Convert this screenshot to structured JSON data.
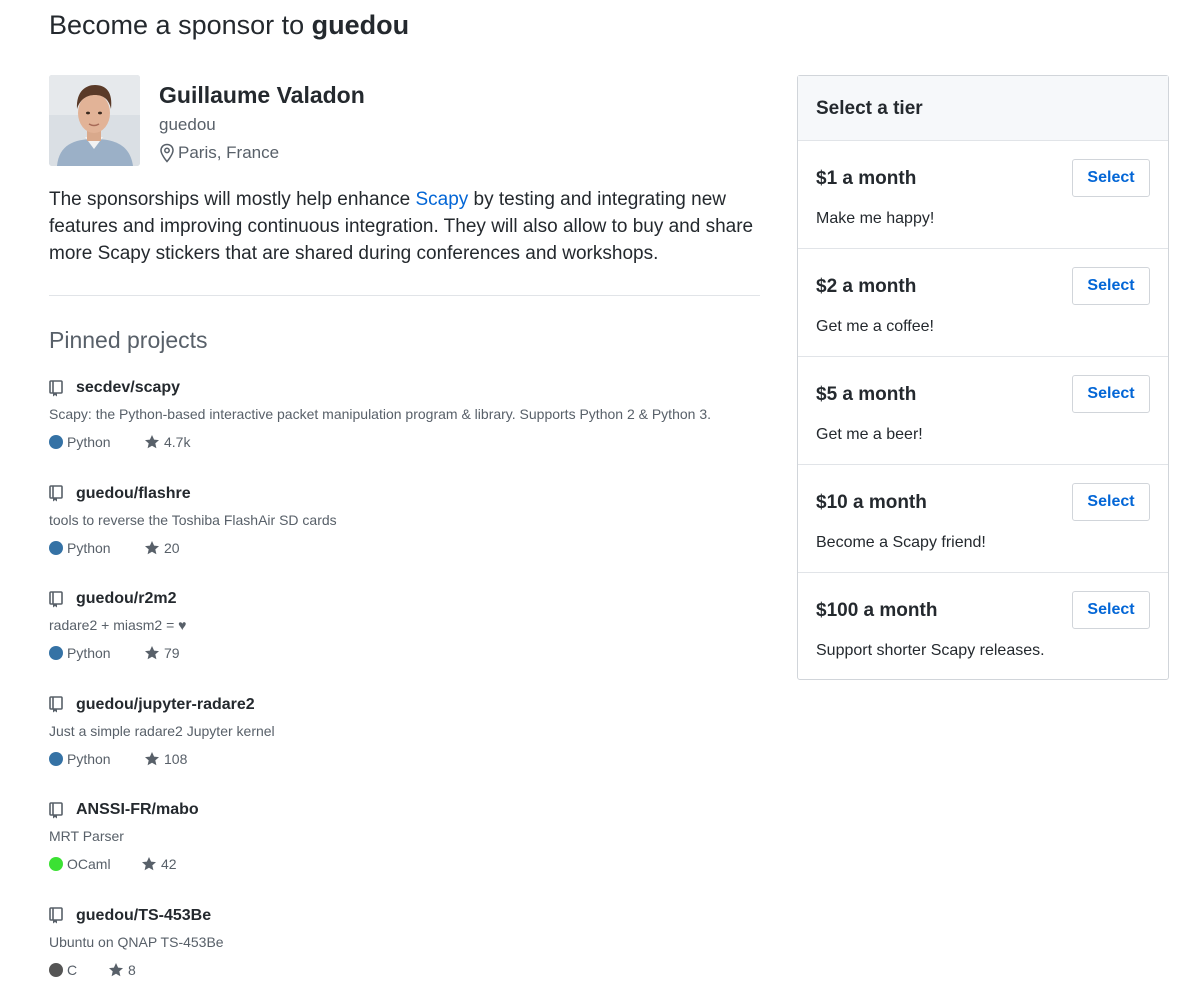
{
  "header": {
    "title_prefix": "Become a sponsor to",
    "title_user": "guedou"
  },
  "profile": {
    "name": "Guillaume Valadon",
    "login": "guedou",
    "location": "Paris, France",
    "location_icon": "location-pin-icon"
  },
  "bio": {
    "before_link": "The sponsorships will mostly help enhance ",
    "link_text": "Scapy",
    "after_link": " by testing and integrating new features and improving continuous integration. They will also allow to buy and share more Scapy stickers that are shared during conferences and workshops."
  },
  "pinned": {
    "title": "Pinned projects",
    "projects": [
      {
        "name": "secdev/scapy",
        "description": "Scapy: the Python-based interactive packet manipulation program & library. Supports Python 2 & Python 3.",
        "language": "Python",
        "language_color": "#3572A5",
        "stars": "4.7k"
      },
      {
        "name": "guedou/flashre",
        "description": "tools to reverse the Toshiba FlashAir SD cards",
        "language": "Python",
        "language_color": "#3572A5",
        "stars": "20"
      },
      {
        "name": "guedou/r2m2",
        "description": "radare2 + miasm2 = ♥",
        "language": "Python",
        "language_color": "#3572A5",
        "stars": "79"
      },
      {
        "name": "guedou/jupyter-radare2",
        "description": "Just a simple radare2 Jupyter kernel",
        "language": "Python",
        "language_color": "#3572A5",
        "stars": "108"
      },
      {
        "name": "ANSSI-FR/mabo",
        "description": "MRT Parser",
        "language": "OCaml",
        "language_color": "#3be133",
        "stars": "42"
      },
      {
        "name": "guedou/TS-453Be",
        "description": "Ubuntu on QNAP TS-453Be",
        "language": "C",
        "language_color": "#555555",
        "stars": "8"
      }
    ]
  },
  "tiers": {
    "title": "Select a tier",
    "button_label": "Select",
    "items": [
      {
        "price": "$1 a month",
        "description": "Make me happy!"
      },
      {
        "price": "$2 a month",
        "description": "Get me a coffee!"
      },
      {
        "price": "$5 a month",
        "description": "Get me a beer!"
      },
      {
        "price": "$10 a month",
        "description": "Become a Scapy friend!"
      },
      {
        "price": "$100 a month",
        "description": "Support shorter Scapy releases."
      }
    ]
  },
  "colors": {
    "link": "#0366d6",
    "text": "#24292e",
    "muted": "#586069"
  }
}
